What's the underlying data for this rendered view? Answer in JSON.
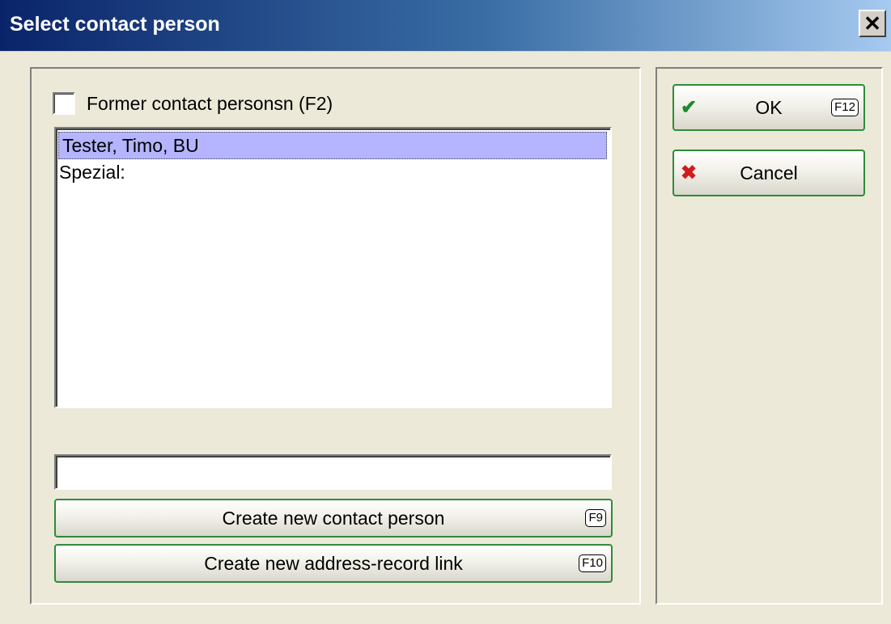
{
  "window": {
    "title": "Select contact person",
    "close_glyph": "✕"
  },
  "former_checkbox": {
    "label": "Former contact personsn (F2)",
    "checked": false
  },
  "contacts_list": {
    "items": [
      {
        "label": "Tester, Timo, BU",
        "selected": true
      },
      {
        "label": "Spezial:",
        "selected": false
      }
    ]
  },
  "search_field": {
    "value": ""
  },
  "buttons": {
    "create_contact": {
      "label": "Create new contact person",
      "hotkey": "F9"
    },
    "create_link": {
      "label": "Create new address-record link",
      "hotkey": "F10"
    },
    "ok": {
      "label": "OK",
      "hotkey": "F12",
      "icon": "check-icon"
    },
    "cancel": {
      "label": "Cancel",
      "icon": "x-icon"
    }
  },
  "colors": {
    "title_gradient_start": "#0a246a",
    "title_gradient_end": "#a6caf0",
    "selection": "#b4b4ff",
    "button_border": "#2e8b3a"
  }
}
